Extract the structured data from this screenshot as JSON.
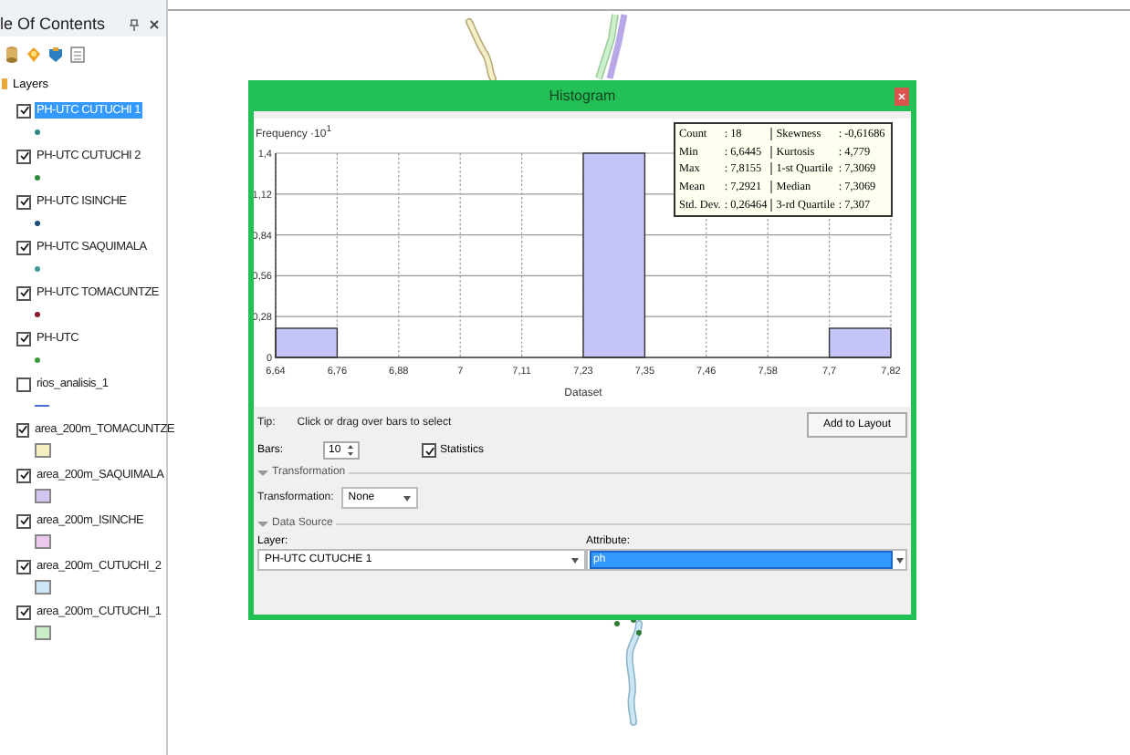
{
  "toc": {
    "title": "le Of Contents",
    "root": {
      "label": "Layers",
      "children": [
        {
          "label": "PH-UTC CUTUCHI 1",
          "checked": true,
          "selected": true,
          "kind": "point",
          "color": "#2a8a8a"
        },
        {
          "label": "PH-UTC CUTUCHI 2",
          "checked": true,
          "selected": false,
          "kind": "point",
          "color": "#2e8b3e"
        },
        {
          "label": "PH-UTC ISINCHE",
          "checked": true,
          "selected": false,
          "kind": "point",
          "color": "#1f4e79"
        },
        {
          "label": "PH-UTC SAQUIMALA",
          "checked": true,
          "selected": false,
          "kind": "point",
          "color": "#3a9a9a"
        },
        {
          "label": "PH-UTC TOMACUNTZE",
          "checked": true,
          "selected": false,
          "kind": "point",
          "color": "#8b1a2a"
        },
        {
          "label": "PH-UTC",
          "checked": true,
          "selected": false,
          "kind": "point",
          "color": "#3a9a3a"
        },
        {
          "label": "rios_analisis_1",
          "checked": false,
          "selected": false,
          "kind": "line",
          "color": "#4a6fd0"
        },
        {
          "label": "area_200m_TOMACUNTZE",
          "checked": true,
          "selected": false,
          "kind": "fill",
          "color": "#f3efc0"
        },
        {
          "label": "area_200m_SAQUIMALA",
          "checked": true,
          "selected": false,
          "kind": "fill",
          "color": "#d3c6f0"
        },
        {
          "label": "area_200m_ISINCHE",
          "checked": true,
          "selected": false,
          "kind": "fill",
          "color": "#ecc8ec"
        },
        {
          "label": "area_200m_CUTUCHI_2",
          "checked": true,
          "selected": false,
          "kind": "fill",
          "color": "#cde6f5"
        },
        {
          "label": "area_200m_CUTUCHI_1",
          "checked": true,
          "selected": false,
          "kind": "fill",
          "color": "#c9ecc9"
        }
      ]
    }
  },
  "histogram": {
    "title": "Histogram",
    "chart_data": {
      "type": "bar",
      "xlabel": "Dataset",
      "ylabel": "Frequency ·10$^{1}$",
      "x": [
        6.70305,
        6.82015,
        6.93725,
        7.05435,
        7.17145,
        7.28855,
        7.40565,
        7.52275,
        7.63985,
        7.75695
      ],
      "values": [
        0.2,
        0,
        0,
        0,
        0,
        1.4,
        0,
        0,
        0,
        0.2
      ],
      "grid": true,
      "xlim": [
        6.6445,
        7.8155
      ],
      "ylim": [
        0,
        1.4
      ],
      "xticks": [
        {
          "value": 6.6445,
          "label": "6,64"
        },
        {
          "value": 6.7616,
          "label": "6,76"
        },
        {
          "value": 6.8787,
          "label": "6,88"
        },
        {
          "value": 6.9958,
          "label": "7"
        },
        {
          "value": 7.1129,
          "label": "7,11"
        },
        {
          "value": 7.23,
          "label": "7,23"
        },
        {
          "value": 7.3471,
          "label": "7,35"
        },
        {
          "value": 7.4642,
          "label": "7,46"
        },
        {
          "value": 7.5813,
          "label": "7,58"
        },
        {
          "value": 7.6984,
          "label": "7,7"
        },
        {
          "value": 7.8155,
          "label": "7,82"
        }
      ],
      "yticks": [
        {
          "value": 0,
          "label": "0"
        },
        {
          "value": 0.28,
          "label": "0,28"
        },
        {
          "value": 0.56,
          "label": "0,56"
        },
        {
          "value": 0.84,
          "label": "0,84"
        },
        {
          "value": 1.12,
          "label": "1,12"
        },
        {
          "value": 1.4,
          "label": "1,4"
        }
      ]
    },
    "statistics": [
      {
        "label": "Count",
        "value": ": 18"
      },
      {
        "label": "Min",
        "value": ": 6,6445"
      },
      {
        "label": "Max",
        "value": ": 7,8155"
      },
      {
        "label": "Mean",
        "value": ": 7,2921"
      },
      {
        "label": "Std. Dev.",
        "value": ": 0,26464"
      },
      {
        "label": "Skewness",
        "value": ": -0,61686"
      },
      {
        "label": "Kurtosis",
        "value": ": 4,779"
      },
      {
        "label": "1-st Quartile",
        "value": ": 7,3069"
      },
      {
        "label": "Median",
        "value": ": 7,3069"
      },
      {
        "label": "3-rd Quartile",
        "value": ": 7,307"
      }
    ],
    "tip_label": "Tip:",
    "tip": "Click or drag over bars to select",
    "add_button": "Add to Layout",
    "bars_label": "Bars:",
    "bars_value": "10",
    "statistics_checkbox": {
      "label": "Statistics",
      "checked": true
    },
    "transformation_section": {
      "title": "Transformation",
      "expanded": true,
      "label": "Transformation:",
      "value": "None"
    },
    "data_source_section": {
      "title": "Data Source",
      "expanded": true,
      "layer_label": "Layer:",
      "layer_value": "PH-UTC CUTUCHE 1",
      "attribute_label": "Attribute:",
      "attribute_value": "ph"
    }
  }
}
